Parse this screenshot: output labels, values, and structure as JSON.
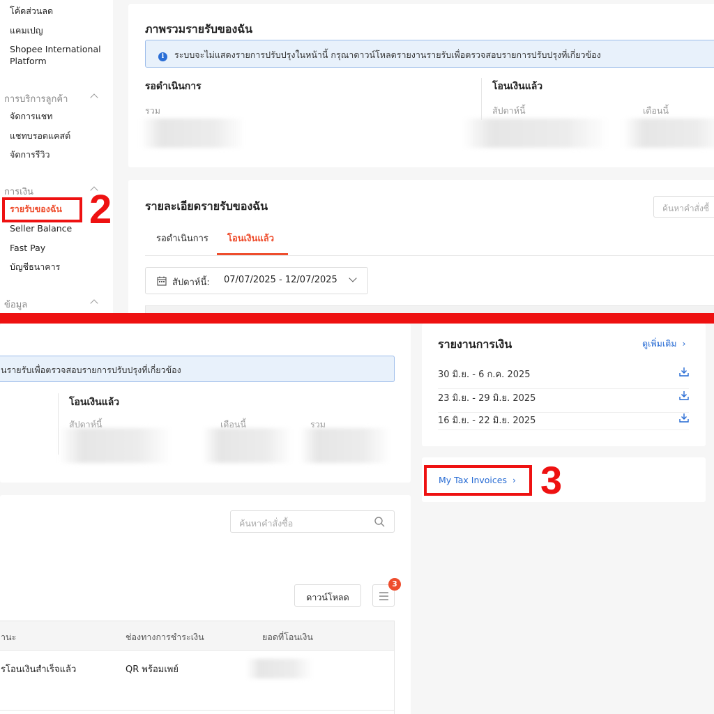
{
  "sidebar": {
    "items_top": [
      "โค้ดส่วนลด",
      "แคมเปญ",
      "Shopee International",
      "Platform"
    ],
    "section_customer": "การบริการลูกค้า",
    "customer_items": [
      "จัดการแชท",
      "แชทบรอดแคสต์",
      "จัดการรีวิว"
    ],
    "section_finance": "การเงิน",
    "finance_items": [
      "รายรับของฉัน",
      "Seller Balance",
      "Fast Pay",
      "บัญชีธนาคาร"
    ],
    "section_data": "ข้อมูล"
  },
  "annotations": {
    "step2": "2",
    "step3": "3"
  },
  "overview": {
    "title": "ภาพรวมรายรับของฉัน",
    "notice": "ระบบจะไม่แสดงรายการปรับปรุงในหน้านี้ กรุณาดาวน์โหลดรายงานรายรับเพื่อตรวจสอบรายการปรับปรุงที่เกี่ยวข้อง",
    "notice_partial": "นรายรับเพื่อตรวจสอบรายการปรับปรุงที่เกี่ยวข้อง",
    "pending_title": "รอดำเนินการ",
    "pending_total_label": "รวม",
    "released_title": "โอนเงินแล้ว",
    "this_week": "สัปดาห์นี้",
    "this_month": "เดือนนี้",
    "total": "รวม"
  },
  "details": {
    "title": "รายละเอียดรายรับของฉัน",
    "search_placeholder_top": "ค้นหาคำสั่งซื้",
    "search_placeholder": "ค้นหาคำสั่งซื้อ",
    "tabs": [
      "รอดำเนินการ",
      "โอนเงินแล้ว"
    ],
    "active_tab": 1,
    "date_label": "สัปดาห์นี้:",
    "date_range": "07/07/2025 - 12/07/2025",
    "download_button": "ดาวน์โหลด",
    "filter_badge": "3",
    "table_headers": [
      "านะ",
      "ช่องทางการชำระเงิน",
      "ยอดที่โอนเงิน"
    ],
    "rows": [
      {
        "status": "รโอนเงินสำเร็จแล้ว",
        "payment": "QR พร้อมเพย์"
      }
    ]
  },
  "reports": {
    "title": "รายงานการเงิน",
    "more_link": "ดูเพิ่มเติม",
    "items": [
      "30 มิ.ย. - 6 ก.ค. 2025",
      "23 มิ.ย. - 29 มิ.ย. 2025",
      "16 มิ.ย. - 22 มิ.ย. 2025"
    ]
  },
  "tax": {
    "link": "My Tax Invoices"
  },
  "colors": {
    "brand": "#ee4d2d",
    "link": "#2469d3",
    "annotation": "#ee1111"
  }
}
